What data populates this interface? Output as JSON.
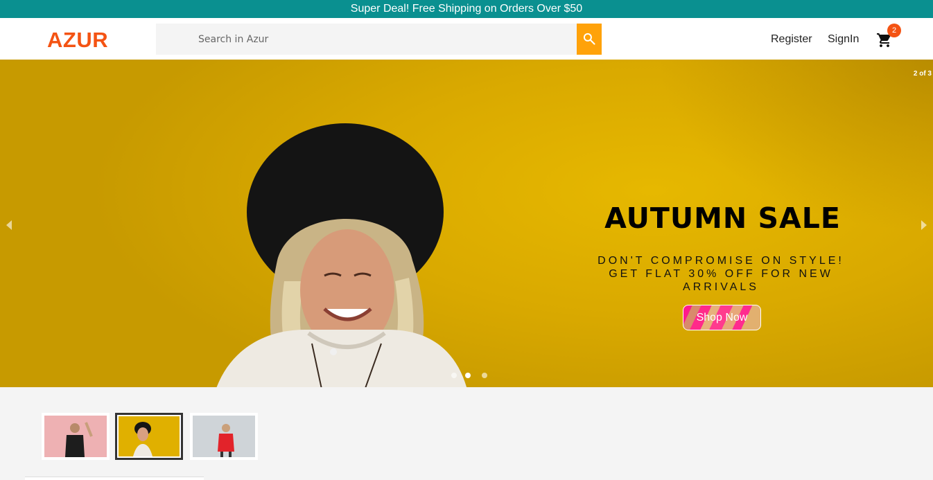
{
  "topbar": {
    "text": "Super Deal! Free Shipping on Orders Over $50"
  },
  "header": {
    "logo": "AZUR",
    "search_placeholder": "Search in Azur",
    "register": "Register",
    "signin": "SignIn",
    "cart_count": "2"
  },
  "hero": {
    "counter": "2 of 3",
    "title": "AUTUMN SALE",
    "subtitle": "DON'T COMPROMISE ON STYLE! GET FLAT 30% OFF FOR NEW ARRIVALS",
    "cta": "Shop Now",
    "active_slide": 2,
    "total_slides": 3
  },
  "colors": {
    "topbar": "#0a9090",
    "logo": "#f45313",
    "search_button": "#ffa20a",
    "hero_background": "#e0b000"
  },
  "icons": {
    "search": "search-icon",
    "cart": "cart-icon",
    "prev": "chevron-left-icon",
    "next": "chevron-right-icon"
  }
}
